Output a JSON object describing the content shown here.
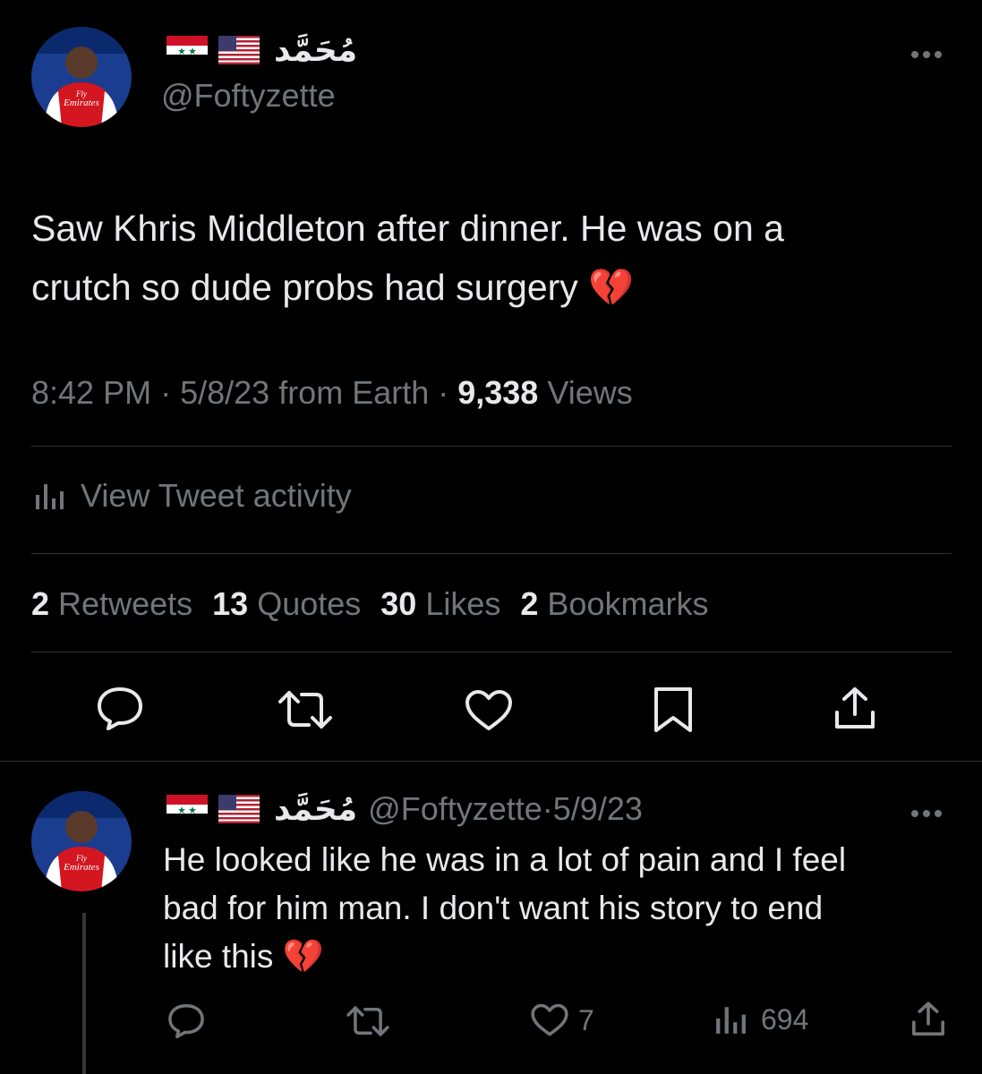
{
  "tweet": {
    "display_name": "مُحَمَّد",
    "handle": "@Foftyzette",
    "text_line1": "Saw Khris Middleton after dinner. He was on a",
    "text_line2": "crutch so dude probs had surgery",
    "emoji": "💔",
    "time": "8:42 PM",
    "date": "5/8/23",
    "source": "from Earth",
    "views_count": "9,338",
    "views_label": "Views",
    "activity_label": "View Tweet activity",
    "stats": [
      {
        "count": "2",
        "label": "Retweets"
      },
      {
        "count": "13",
        "label": "Quotes"
      },
      {
        "count": "30",
        "label": "Likes"
      },
      {
        "count": "2",
        "label": "Bookmarks"
      }
    ]
  },
  "reply": {
    "display_name": "مُحَمَّد",
    "handle": "@Foftyzette",
    "date": "5/9/23",
    "text_line1": "He looked like he was in a lot of pain and I feel",
    "text_line2": "bad for him man. I don't want his story to end",
    "text_line3": "like this",
    "emoji": "💔",
    "likes": "7",
    "views": "694"
  },
  "avatar_text": {
    "line1": "Fly",
    "line2": "Emirates"
  },
  "icons": [
    "syria-flag-icon",
    "us-flag-icon",
    "more-icon",
    "chart-icon",
    "reply-icon",
    "retweet-icon",
    "like-icon",
    "bookmark-icon",
    "share-icon"
  ],
  "colors": {
    "background": "#000000",
    "text": "#e7e9ea",
    "muted": "#71767b",
    "divider": "#2f3336",
    "heart": "#c9184a"
  }
}
